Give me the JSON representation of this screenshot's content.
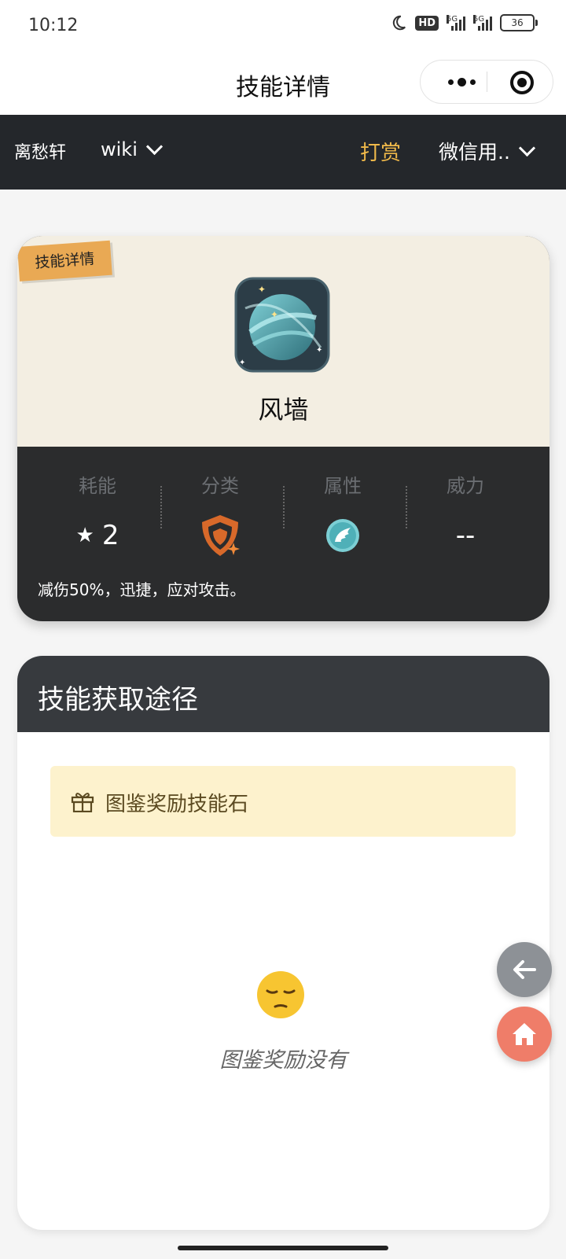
{
  "status_bar": {
    "time": "10:12",
    "hd_label": "HD",
    "signal_labels": [
      "5G",
      "5G"
    ],
    "battery": "36"
  },
  "title_bar": {
    "title": "技能详情"
  },
  "nav": {
    "site": "离愁轩",
    "wiki": "wiki",
    "reward": "打赏",
    "user": "微信用.."
  },
  "skill": {
    "ribbon": "技能详情",
    "name": "风墙",
    "icon": "planet-icon",
    "stats": {
      "cost_label": "耗能",
      "cost_value": "2",
      "category_label": "分类",
      "category_icon": "defense-shield-icon",
      "attribute_label": "属性",
      "attribute_icon": "wing-icon",
      "power_label": "威力",
      "power_value": "--"
    },
    "description": "减伤50%，迅捷，应对攻击。"
  },
  "acquisition": {
    "title": "技能获取途径",
    "items": [
      {
        "icon": "gift-icon",
        "label": "图鉴奖励技能石"
      }
    ],
    "empty_emoji": "pensive-face",
    "empty_text": "图鉴奖励没有"
  },
  "colors": {
    "accent": "#f0b94a",
    "nav_bg": "#24272b",
    "card_bg": "#f3eee2",
    "home_button": "#ef7d69"
  }
}
